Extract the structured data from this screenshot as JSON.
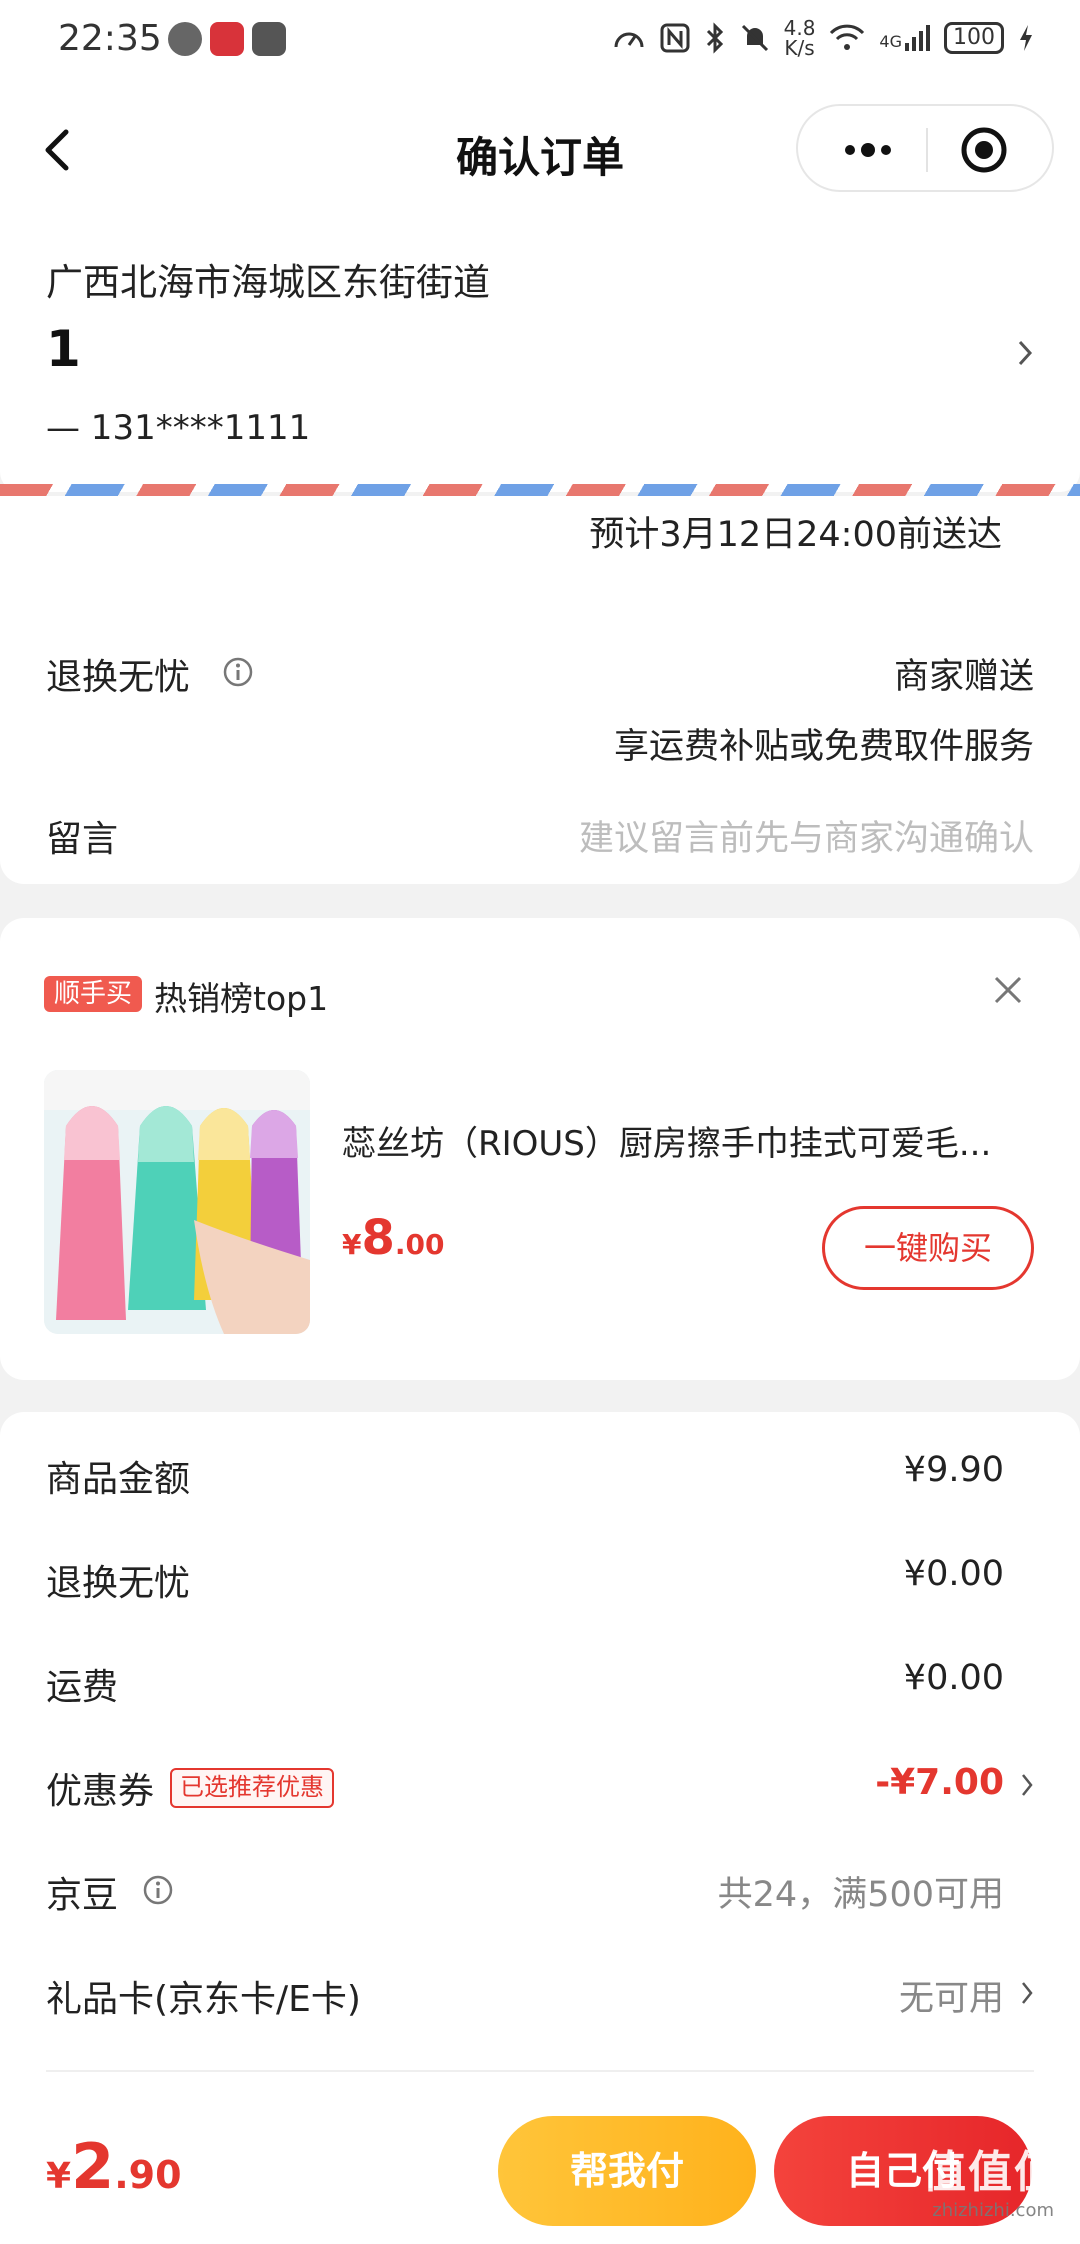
{
  "status_bar": {
    "time": "22:35",
    "network_speed": "4.8",
    "network_speed_unit": "K/s",
    "signal": "4G",
    "battery": "100"
  },
  "nav": {
    "title": "确认订单"
  },
  "address": {
    "full_address": "广西北海市海城区东街街道",
    "recipient_name": "1",
    "phone": "— 131****1111"
  },
  "delivery": {
    "eta": "预计3月12日24:00前送达"
  },
  "options": {
    "return_label": "退换无忧",
    "return_value": "商家赠送",
    "return_desc": "享运费补贴或免费取件服务",
    "message_label": "留言",
    "message_placeholder": "建议留言前先与商家沟通确认"
  },
  "upsell": {
    "badge": "顺手买",
    "title": "热销榜top1",
    "product_name": "蕊丝坊（RIOUS）厨房擦手巾挂式可爱毛...",
    "price_currency": "¥",
    "price_int": "8",
    "price_dec": ".00",
    "buy_button": "一键购买"
  },
  "summary": {
    "rows": [
      {
        "label": "商品金额",
        "value": "¥9.90"
      },
      {
        "label": "退换无忧",
        "value": "¥0.00"
      },
      {
        "label": "运费",
        "value": "¥0.00"
      },
      {
        "label": "优惠券",
        "tag": "已选推荐优惠",
        "value": "-¥7.00"
      },
      {
        "label": "京豆",
        "value": "共24，满500可用"
      },
      {
        "label": "礼品卡(京东卡/E卡)",
        "value": "无可用"
      }
    ]
  },
  "bottom": {
    "total_currency": "¥",
    "total_int": "2",
    "total_dec": ".90",
    "help_pay": "帮我付",
    "self_pay": "自己付",
    "watermark": "值值值",
    "watermark_sub": "zhizhizhi.com"
  },
  "colors": {
    "accent_red": "#e4372f",
    "help_pay_yellow": "#ffc53a",
    "background": "#f2f2f2"
  }
}
